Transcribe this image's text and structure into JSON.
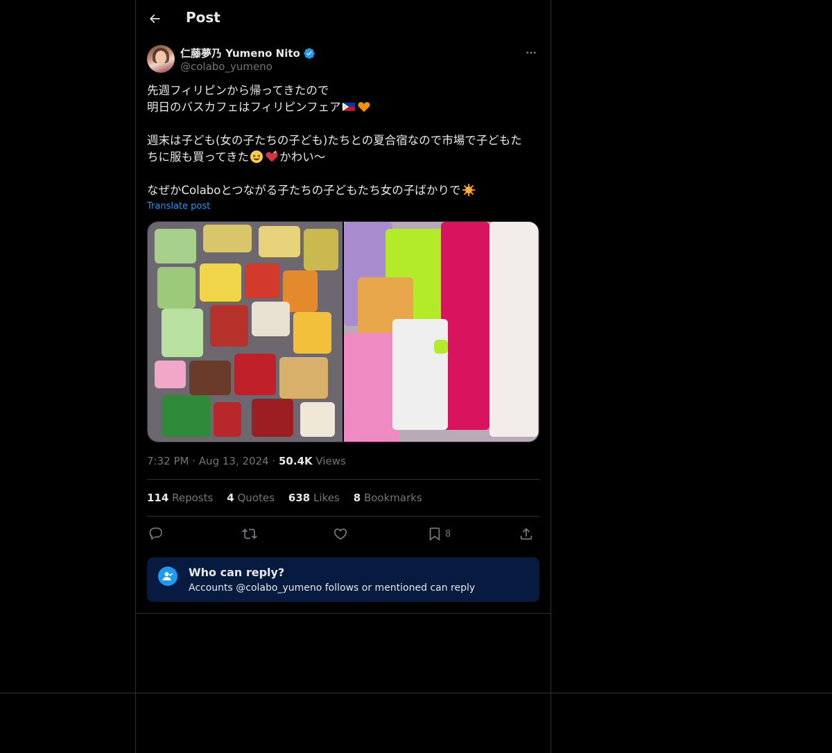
{
  "header": {
    "title": "Post"
  },
  "author": {
    "name": "仁藤夢乃 Yumeno Nito",
    "handle": "@colabo_yumeno"
  },
  "tweet": {
    "line1": "先週フィリピンから帰ってきたので",
    "line2": "明日のバスカフェはフィリピンフェア",
    "line3": "週末は子ども(女の子たちの子ども)たちとの夏合宿なので市場で子どもた",
    "line4a": "ちに服も買ってきた",
    "line4b": "かわい〜",
    "line5a": "なぜかColaboとつながる子たちの子どもたち女の子ばかりで",
    "translate_label": "Translate post",
    "emojis": [
      "philippines-flag",
      "orange-heart",
      "grinning-squinting-face",
      "heart-with-ribbon",
      "sun-behind"
    ]
  },
  "media": [
    {
      "label": "snacks-photo"
    },
    {
      "label": "clothes-photo"
    }
  ],
  "meta": {
    "time": "7:32 PM",
    "date": "Aug 13, 2024",
    "views_count": "50.4K",
    "views_label": "Views",
    "sep": "·"
  },
  "stats": {
    "reposts_count": "114",
    "reposts_label": "Reposts",
    "quotes_count": "4",
    "quotes_label": "Quotes",
    "likes_count": "638",
    "likes_label": "Likes",
    "bookmarks_count": "8",
    "bookmarks_label": "Bookmarks"
  },
  "actions": {
    "bookmark_count": "8"
  },
  "reply_restriction": {
    "title": "Who can reply?",
    "subtitle": "Accounts @colabo_yumeno follows or mentioned can reply"
  },
  "colors": {
    "background": "#000000",
    "border": "#2f3336",
    "text": "#e7e9ea",
    "secondary": "#71767b",
    "accent": "#1d9bf0",
    "reply_box": "#071a3f"
  }
}
